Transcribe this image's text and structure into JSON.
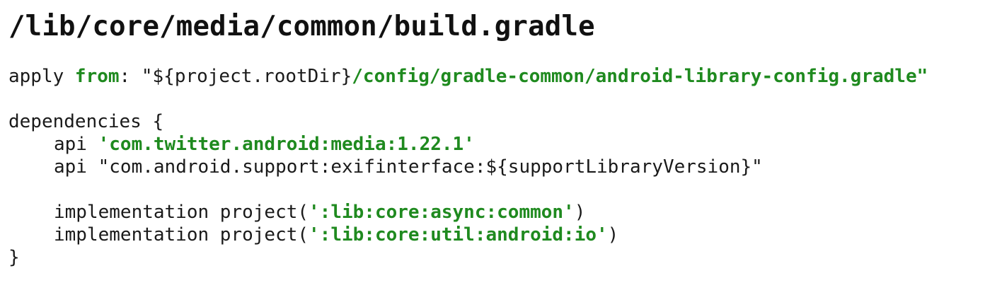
{
  "title": "/lib/core/media/common/build.gradle",
  "code": {
    "apply_keyword": "apply ",
    "from_keyword": "from",
    "apply_colon": ": ",
    "apply_string_prefix": "\"${project.rootDir}",
    "apply_string_path": "/config/gradle-common/android-library-config.gradle\"",
    "dependencies_open": "dependencies {",
    "api_keyword_1": "api ",
    "api_value_1": "'com.twitter.android:media:1.22.1'",
    "api_keyword_2": "api ",
    "api_value_2": "\"com.android.support:exifinterface:${supportLibraryVersion}\"",
    "impl_keyword_1": "implementation project(",
    "impl_value_1": "':lib:core:async:common'",
    "impl_close_1": ")",
    "impl_keyword_2": "implementation project(",
    "impl_value_2": "':lib:core:util:android:io'",
    "impl_close_2": ")",
    "dependencies_close": "}"
  },
  "colors": {
    "string_green": "#1f8a1f",
    "text": "#1a1a1a",
    "background": "#ffffff"
  }
}
